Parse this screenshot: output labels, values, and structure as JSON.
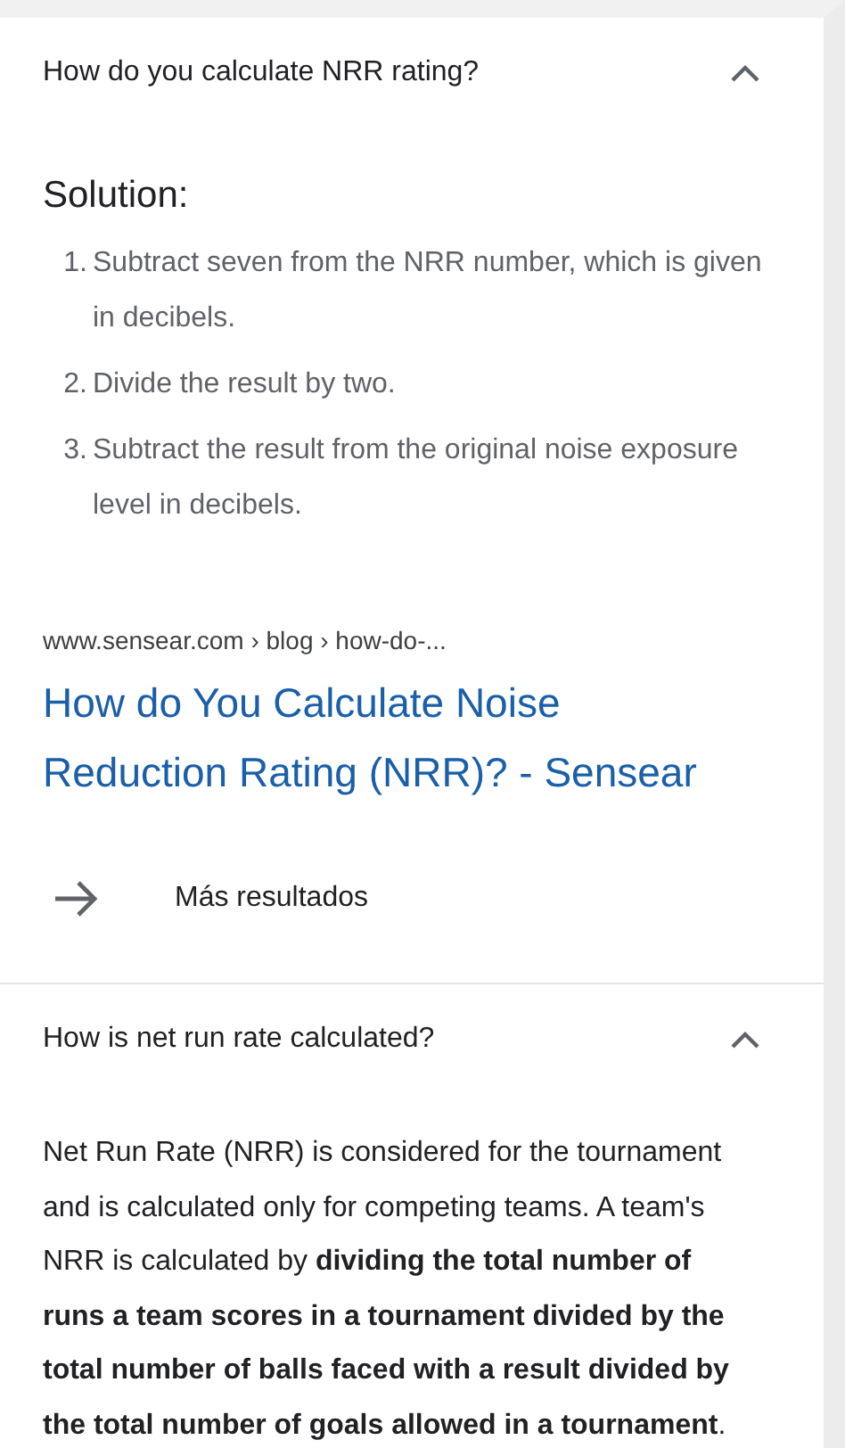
{
  "questions": [
    {
      "question": "How do you calculate NRR rating?",
      "expanded": true,
      "kind": "list",
      "heading": "Solution:",
      "steps": [
        {
          "number": "1.",
          "text": "Subtract seven from the NRR number, which is given in decibels."
        },
        {
          "number": "2.",
          "text": "Divide the result by two."
        },
        {
          "number": "3.",
          "text": "Subtract the result from the original noise exposure level in decibels."
        }
      ],
      "source": {
        "url": "www.sensear.com › blog › how-do-...",
        "title": "How do You Calculate Noise Reduction Rating (NRR)? - Sensear"
      },
      "more_results": "Más resultados"
    },
    {
      "question": "How is net run rate calculated?",
      "expanded": true,
      "kind": "paragraph",
      "answer": "Net Run Rate (NRR) is considered for the tournament and is calculated only for competing teams. A team's NRR is calculated by **dividing the total number of runs a team scores in a tournament divided by the total number of balls faced with a result divided by the total number of goals allowed in a tournament**."
    }
  ]
}
